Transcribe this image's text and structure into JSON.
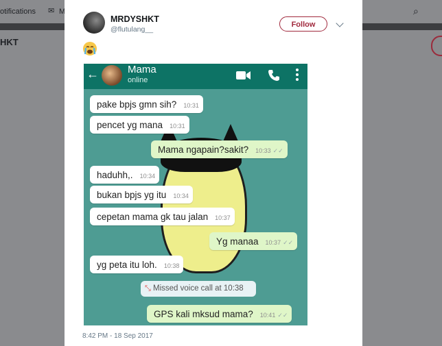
{
  "background": {
    "nav_notifications": "otifications",
    "nav_messages": "M",
    "profile_name": "HKT"
  },
  "tweet": {
    "display_name": "MRDYSHKT",
    "handle": "@flutulang__",
    "follow_label": "Follow",
    "emoji": "😭",
    "timestamp": "8:42 PM - 18 Sep 2017"
  },
  "whatsapp": {
    "contact_name": "Mama",
    "contact_status": "online",
    "messages": [
      {
        "text": "pake bpjs gmn sih?",
        "time": "10:31",
        "direction": "in"
      },
      {
        "text": "pencet yg mana",
        "time": "10:31",
        "direction": "in"
      },
      {
        "text": "Mama ngapain?sakit?",
        "time": "10:33",
        "direction": "out"
      },
      {
        "text": "haduhh,.",
        "time": "10:34",
        "direction": "in"
      },
      {
        "text": "bukan bpjs yg itu",
        "time": "10:34",
        "direction": "in"
      },
      {
        "text": "cepetan mama gk tau jalan",
        "time": "10:37",
        "direction": "in"
      },
      {
        "text": "Yg manaa",
        "time": "10:37",
        "direction": "out"
      },
      {
        "text": "yg peta itu loh.",
        "time": "10:38",
        "direction": "in"
      },
      {
        "text": "GPS kali mksud mama?",
        "time": "10:41",
        "direction": "out"
      }
    ],
    "missed_call": "Missed voice call at 10:38"
  },
  "colors": {
    "follow_accent": "#a0283c",
    "wa_header": "#0d7365",
    "outgoing_bubble": "#dff6c8"
  }
}
